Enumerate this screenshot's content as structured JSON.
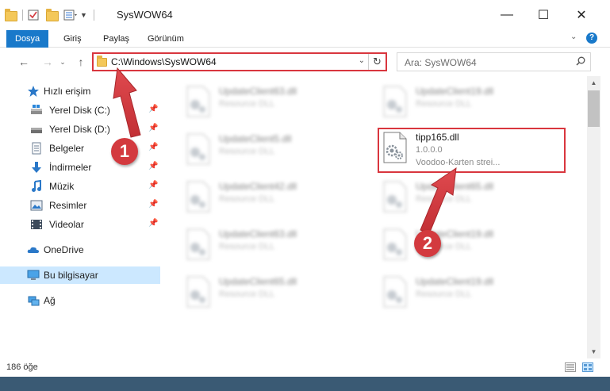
{
  "window": {
    "title": "SysWOW64",
    "minimize": "—",
    "maximize": "☐",
    "close": "✕"
  },
  "ribbon": {
    "tabs": [
      "Dosya",
      "Giriş",
      "Paylaş",
      "Görünüm"
    ]
  },
  "address": {
    "path": "C:\\Windows\\SysWOW64",
    "search_placeholder": "Ara: SysWOW64"
  },
  "navigation": {
    "quick_access": "Hızlı erişim",
    "items": [
      {
        "label": "Yerel Disk (C:)",
        "icon": "drive-icon",
        "pinned": true
      },
      {
        "label": "Yerel Disk (D:)",
        "icon": "drive-icon",
        "pinned": true
      },
      {
        "label": "Belgeler",
        "icon": "documents-icon",
        "pinned": true
      },
      {
        "label": "İndirmeler",
        "icon": "download-icon",
        "pinned": true
      },
      {
        "label": "Müzik",
        "icon": "music-icon",
        "pinned": true
      },
      {
        "label": "Resimler",
        "icon": "pictures-icon",
        "pinned": true
      },
      {
        "label": "Videolar",
        "icon": "videos-icon",
        "pinned": true
      }
    ],
    "onedrive": "OneDrive",
    "this_pc": "Bu bilgisayar",
    "network": "Ağ"
  },
  "files": [
    {
      "name": "UpdateClient63.dll",
      "type": "Resource DLL",
      "blurred": true
    },
    {
      "name": "UpdateClient19.dll",
      "type": "Resource DLL",
      "blurred": true
    },
    {
      "name": "UpdateClient5.dll",
      "type": "Resource DLL",
      "blurred": true
    },
    {
      "name": "tipp165.dll",
      "version": "1.0.0.0",
      "description": "Voodoo-Karten strei...",
      "blurred": false
    },
    {
      "name": "UpdateClient42.dll",
      "type": "Resource DLL",
      "blurred": true
    },
    {
      "name": "UpdateClient65.dll",
      "type": "Resource DLL",
      "blurred": true
    },
    {
      "name": "UpdateClient63.dll",
      "type": "Resource DLL",
      "blurred": true
    },
    {
      "name": "UpdateClient19.dll",
      "type": "Resource DLL",
      "blurred": true
    },
    {
      "name": "UpdateClient65.dll",
      "type": "Resource DLL",
      "blurred": true
    },
    {
      "name": "UpdateClient19.dll",
      "type": "Resource DLL",
      "blurred": true
    }
  ],
  "status": {
    "item_count": "186 öğe"
  },
  "annotations": {
    "step1": "1",
    "step2": "2",
    "color": "#d33a3f"
  }
}
